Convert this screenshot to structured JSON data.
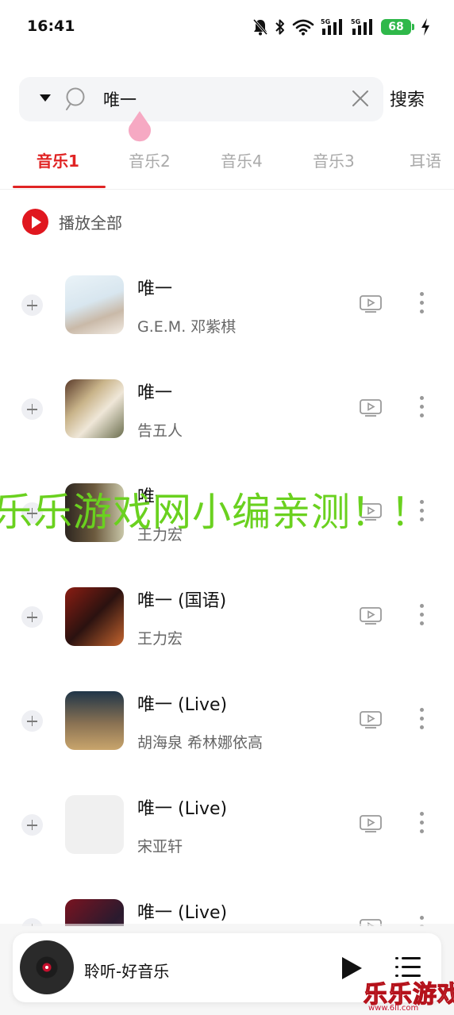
{
  "status_bar": {
    "time": "16:41",
    "battery": "68"
  },
  "search": {
    "query": "唯一",
    "button_label": "搜索"
  },
  "tabs": [
    {
      "label": "音乐1",
      "active": true
    },
    {
      "label": "音乐2",
      "active": false
    },
    {
      "label": "音乐4",
      "active": false
    },
    {
      "label": "音乐3",
      "active": false
    },
    {
      "label": "耳语",
      "active": false
    }
  ],
  "play_all": {
    "label": "播放全部"
  },
  "songs": [
    {
      "title": "唯一",
      "artist": "G.E.M. 邓紫棋"
    },
    {
      "title": "唯一",
      "artist": "告五人"
    },
    {
      "title": "唯一",
      "artist": "王力宏"
    },
    {
      "title": "唯一 (国语)",
      "artist": "王力宏"
    },
    {
      "title": "唯一 (Live)",
      "artist": "胡海泉 希林娜依高"
    },
    {
      "title": "唯一 (Live)",
      "artist": "宋亚轩"
    },
    {
      "title": "唯一 (Live)",
      "artist": ""
    }
  ],
  "watermark": "乐乐游戏网小编亲测！！",
  "player": {
    "title": "聆听-好音乐"
  },
  "corner_logo": {
    "text": "乐乐游戏",
    "url": "www.6ll.com"
  },
  "colors": {
    "accent": "#e02424",
    "watermark": "#6ad11f"
  }
}
